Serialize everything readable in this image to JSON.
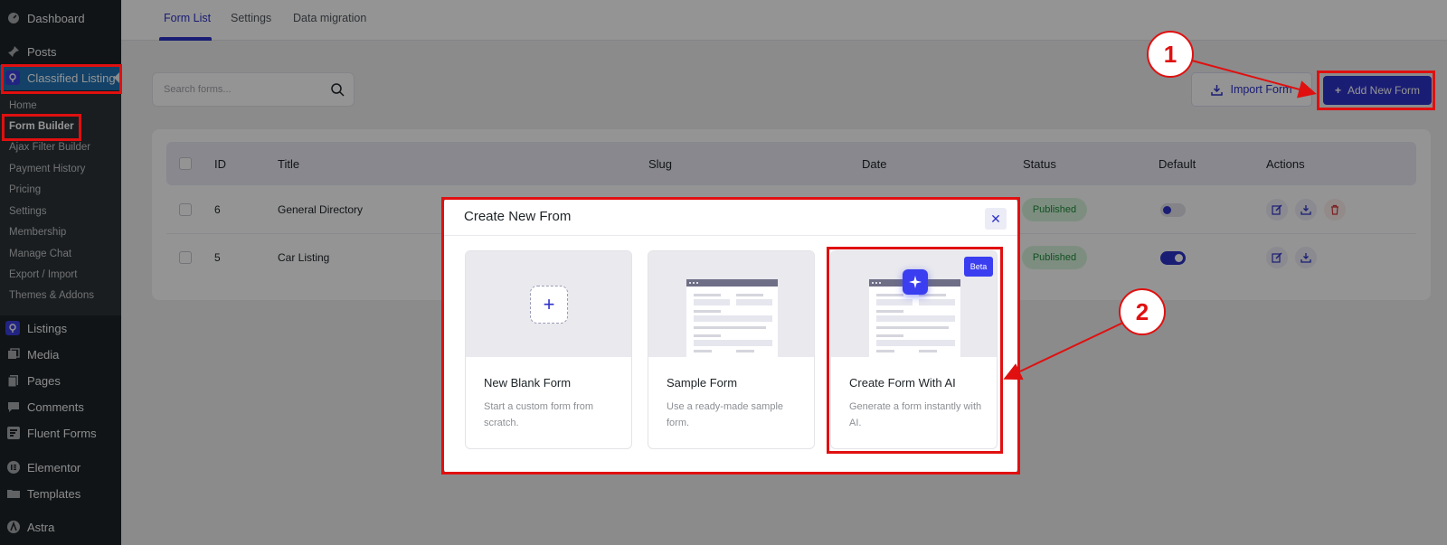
{
  "sidebar": {
    "top_items": [
      {
        "label": "Dashboard",
        "icon": "dashboard-icon"
      },
      {
        "label": "Posts",
        "icon": "pin-icon"
      },
      {
        "label": "Classified Listing",
        "icon": "classified-listing-icon"
      }
    ],
    "sub_items": [
      {
        "label": "Home"
      },
      {
        "label": "Form Builder"
      },
      {
        "label": "Ajax Filter Builder"
      },
      {
        "label": "Payment History"
      },
      {
        "label": "Pricing"
      },
      {
        "label": "Settings"
      },
      {
        "label": "Membership"
      },
      {
        "label": "Manage Chat"
      },
      {
        "label": "Export / Import"
      },
      {
        "label": "Themes & Addons"
      }
    ],
    "bottom_items": [
      {
        "label": "Listings",
        "icon": "listings-icon"
      },
      {
        "label": "Media",
        "icon": "media-icon"
      },
      {
        "label": "Pages",
        "icon": "pages-icon"
      },
      {
        "label": "Comments",
        "icon": "comments-icon"
      },
      {
        "label": "Fluent Forms",
        "icon": "fluent-forms-icon"
      },
      {
        "label": "Elementor",
        "icon": "elementor-icon"
      },
      {
        "label": "Templates",
        "icon": "folder-icon"
      },
      {
        "label": "Astra",
        "icon": "astra-icon"
      }
    ]
  },
  "tabs": [
    {
      "label": "Form List",
      "active": true
    },
    {
      "label": "Settings",
      "active": false
    },
    {
      "label": "Data migration",
      "active": false
    }
  ],
  "search": {
    "placeholder": "Search forms..."
  },
  "toolbar": {
    "import_label": "Import Form",
    "add_label": "Add New Form"
  },
  "table": {
    "headers": [
      "ID",
      "Title",
      "Slug",
      "Date",
      "Status",
      "Default",
      "Actions"
    ],
    "rows": [
      {
        "id": "6",
        "title": "General Directory",
        "status": "Published",
        "default": false
      },
      {
        "id": "5",
        "title": "Car Listing",
        "status": "Published",
        "default": true
      }
    ]
  },
  "modal": {
    "title": "Create New From",
    "close": "✕",
    "cards": [
      {
        "title": "New Blank Form",
        "desc": "Start a custom form from scratch."
      },
      {
        "title": "Sample Form",
        "desc": "Use a ready-made sample form."
      },
      {
        "title": "Create Form With AI",
        "desc": "Generate a form instantly with AI.",
        "badge": "Beta"
      }
    ]
  },
  "annotations": {
    "step1": "1",
    "step2": "2"
  },
  "colors": {
    "accent": "#2e32c9",
    "annotation": "#e01010",
    "wp_sidebar": "#1d2327",
    "wp_active": "#2271b1"
  }
}
